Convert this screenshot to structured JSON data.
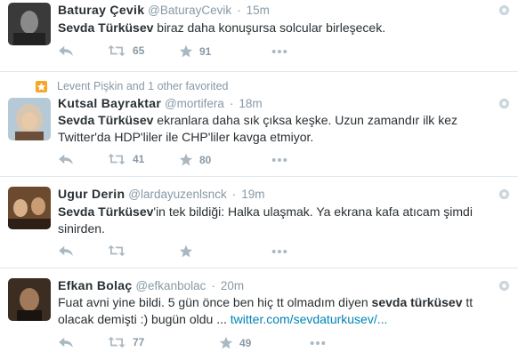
{
  "tweets": [
    {
      "name": "Baturay Çevik",
      "handle": "@BaturayCevik",
      "sep": "·",
      "time": "15m",
      "text_bold": "Sevda Türküsev",
      "text_rest": " biraz daha konuşursa solcular birleşecek.",
      "retweets": "65",
      "favorites": "91"
    },
    {
      "context": "Levent Pişkin and 1 other favorited",
      "name": "Kutsal Bayraktar",
      "handle": "@mortifera",
      "sep": "·",
      "time": "18m",
      "text_bold": "Sevda Türküsev",
      "text_rest": " ekranlara daha sık çıksa keşke. Uzun zamandır ilk kez",
      "text_line2": "Twitter'da HDP'liler ile CHP'liler kavga etmiyor.",
      "retweets": "41",
      "favorites": "80"
    },
    {
      "name": "Ugur Derin",
      "handle": "@lardayuzenlsnck",
      "sep": "·",
      "time": "19m",
      "text_bold": "Sevda Türküsev",
      "text_rest": "'in tek bildiği: Halka ulaşmak. Ya ekrana kafa atıcam şimdi",
      "text_line2": "sinirden.",
      "retweets": "",
      "favorites": ""
    },
    {
      "name": "Efkan Bolaç",
      "handle": "@efkanbolac",
      "sep": "·",
      "time": "20m",
      "text_line1_a": "Fuat avni yine bildi. 5 gün önce ben hiç tt olmadım diyen ",
      "text_line1_bold": "sevda türküsev",
      "text_line1_b": " tt",
      "text_line2_a": "olacak demişti :) bugün oldu ... ",
      "link": "twitter.com/sevdaturkusev/...",
      "retweets": "77",
      "favorites": "49"
    }
  ],
  "colors": {
    "accent": "#0084b4",
    "muted": "#8899a6",
    "text": "#292f33",
    "fav_badge": "#f5a623"
  },
  "icons": [
    "reply-icon",
    "retweet-icon",
    "favorite-icon",
    "more-icon",
    "gear-icon"
  ]
}
